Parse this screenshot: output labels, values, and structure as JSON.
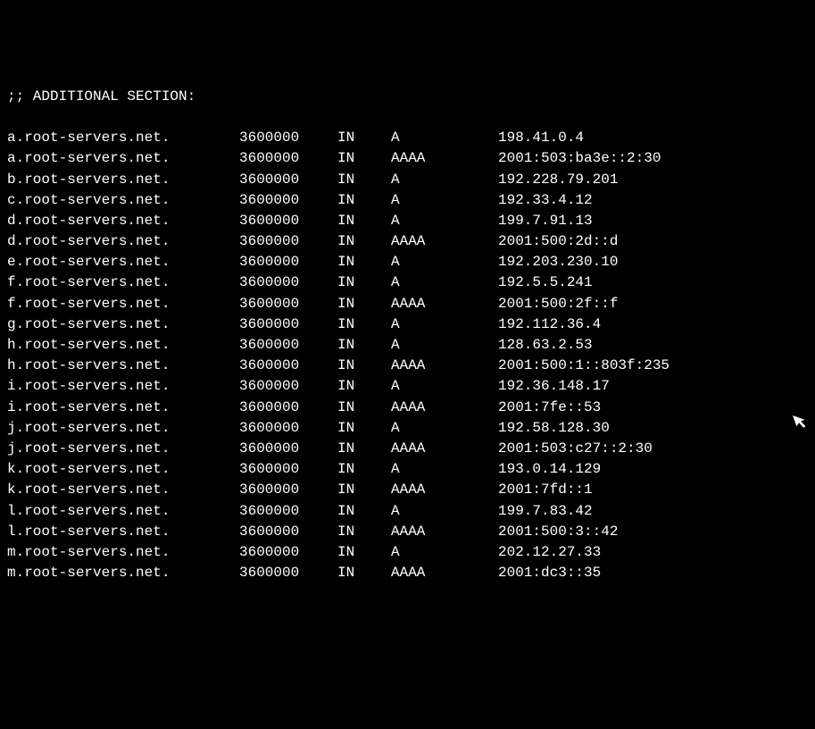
{
  "section_header": ";; ADDITIONAL SECTION:",
  "records": [
    {
      "name": "a.root-servers.net.",
      "ttl": "3600000",
      "class": "IN",
      "type": "A",
      "data": "198.41.0.4"
    },
    {
      "name": "a.root-servers.net.",
      "ttl": "3600000",
      "class": "IN",
      "type": "AAAA",
      "data": "2001:503:ba3e::2:30"
    },
    {
      "name": "b.root-servers.net.",
      "ttl": "3600000",
      "class": "IN",
      "type": "A",
      "data": "192.228.79.201"
    },
    {
      "name": "c.root-servers.net.",
      "ttl": "3600000",
      "class": "IN",
      "type": "A",
      "data": "192.33.4.12"
    },
    {
      "name": "d.root-servers.net.",
      "ttl": "3600000",
      "class": "IN",
      "type": "A",
      "data": "199.7.91.13"
    },
    {
      "name": "d.root-servers.net.",
      "ttl": "3600000",
      "class": "IN",
      "type": "AAAA",
      "data": "2001:500:2d::d"
    },
    {
      "name": "e.root-servers.net.",
      "ttl": "3600000",
      "class": "IN",
      "type": "A",
      "data": "192.203.230.10"
    },
    {
      "name": "f.root-servers.net.",
      "ttl": "3600000",
      "class": "IN",
      "type": "A",
      "data": "192.5.5.241"
    },
    {
      "name": "f.root-servers.net.",
      "ttl": "3600000",
      "class": "IN",
      "type": "AAAA",
      "data": "2001:500:2f::f"
    },
    {
      "name": "g.root-servers.net.",
      "ttl": "3600000",
      "class": "IN",
      "type": "A",
      "data": "192.112.36.4"
    },
    {
      "name": "h.root-servers.net.",
      "ttl": "3600000",
      "class": "IN",
      "type": "A",
      "data": "128.63.2.53"
    },
    {
      "name": "h.root-servers.net.",
      "ttl": "3600000",
      "class": "IN",
      "type": "AAAA",
      "data": "2001:500:1::803f:235"
    },
    {
      "name": "i.root-servers.net.",
      "ttl": "3600000",
      "class": "IN",
      "type": "A",
      "data": "192.36.148.17"
    },
    {
      "name": "i.root-servers.net.",
      "ttl": "3600000",
      "class": "IN",
      "type": "AAAA",
      "data": "2001:7fe::53"
    },
    {
      "name": "j.root-servers.net.",
      "ttl": "3600000",
      "class": "IN",
      "type": "A",
      "data": "192.58.128.30"
    },
    {
      "name": "j.root-servers.net.",
      "ttl": "3600000",
      "class": "IN",
      "type": "AAAA",
      "data": "2001:503:c27::2:30"
    },
    {
      "name": "k.root-servers.net.",
      "ttl": "3600000",
      "class": "IN",
      "type": "A",
      "data": "193.0.14.129"
    },
    {
      "name": "k.root-servers.net.",
      "ttl": "3600000",
      "class": "IN",
      "type": "AAAA",
      "data": "2001:7fd::1"
    },
    {
      "name": "l.root-servers.net.",
      "ttl": "3600000",
      "class": "IN",
      "type": "A",
      "data": "199.7.83.42"
    },
    {
      "name": "l.root-servers.net.",
      "ttl": "3600000",
      "class": "IN",
      "type": "AAAA",
      "data": "2001:500:3::42"
    },
    {
      "name": "m.root-servers.net.",
      "ttl": "3600000",
      "class": "IN",
      "type": "A",
      "data": "202.12.27.33"
    },
    {
      "name": "m.root-servers.net.",
      "ttl": "3600000",
      "class": "IN",
      "type": "AAAA",
      "data": "2001:dc3::35"
    }
  ]
}
